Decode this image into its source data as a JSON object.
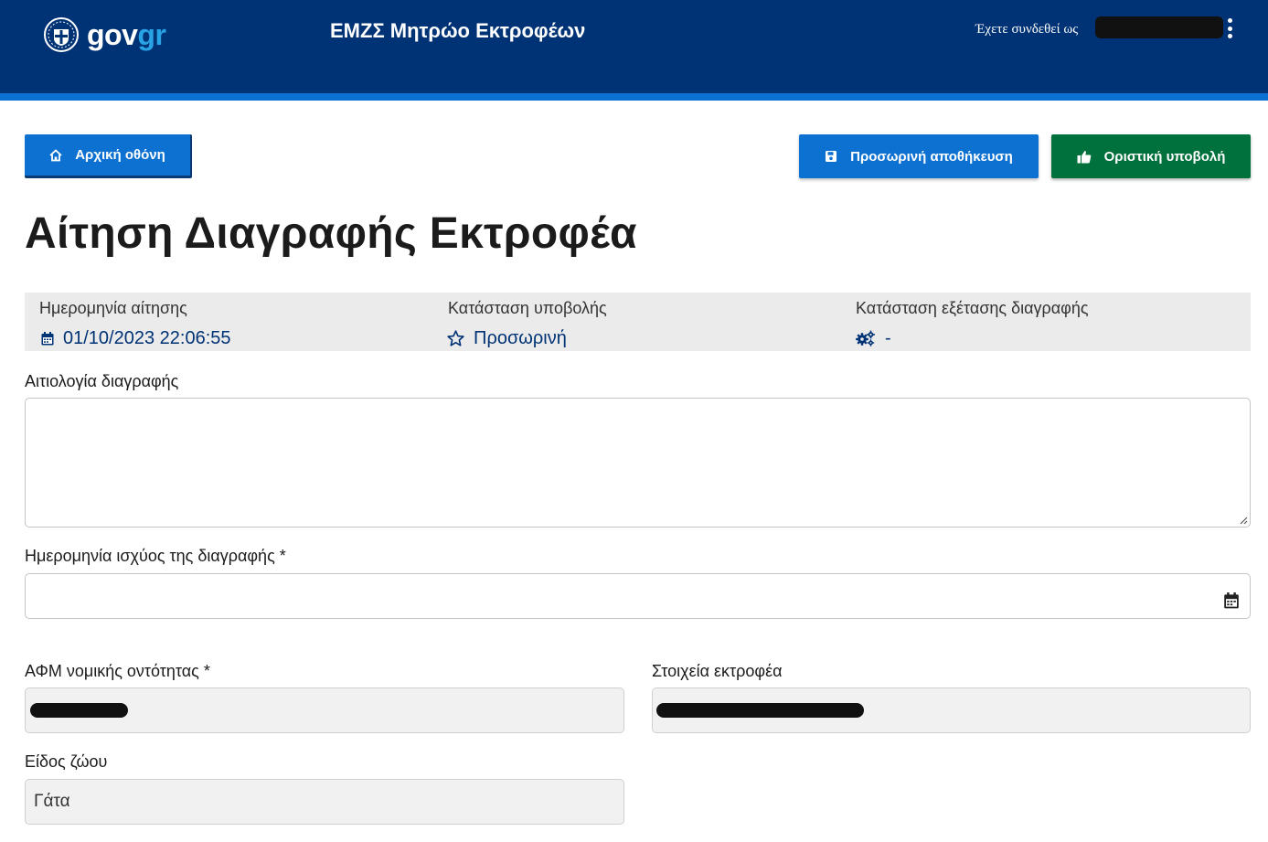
{
  "header": {
    "logo": {
      "gov": "gov",
      "gr": "gr"
    },
    "app_title": "ΕΜΖΣ Μητρώο Εκτροφέων",
    "user_label": "Έχετε συνδεθεί ως",
    "colors": {
      "primary": "#003375",
      "stripe": "#0c71d0",
      "logo_accent": "#29a3e5"
    }
  },
  "actions": {
    "home_label": "Αρχική οθόνη",
    "save_label": "Προσωρινή αποθήκευση",
    "submit_label": "Οριστική υποβολή",
    "colors": {
      "blue": "#0c71d0",
      "green": "#00703c"
    }
  },
  "page_title": "Αίτηση Διαγραφής Εκτροφέα",
  "info": {
    "request_date": {
      "label": "Ημερομηνία αίτησης",
      "value": "01/10/2023 22:06:55",
      "icon": "calendar-icon"
    },
    "submission_status": {
      "label": "Κατάσταση υποβολής",
      "value": "Προσωρινή",
      "icon": "star-outline-icon"
    },
    "review_status": {
      "label": "Κατάσταση εξέτασης διαγραφής",
      "value": "-",
      "icon": "gears-icon"
    }
  },
  "form": {
    "reason": {
      "label": "Αιτιολογία διαγραφής",
      "value": ""
    },
    "effective_date": {
      "label": "Ημερομηνία ισχύος της διαγραφής *",
      "value": ""
    },
    "afm": {
      "label": "ΑΦΜ νομικής οντότητας *"
    },
    "breeder": {
      "label": "Στοιχεία εκτροφέα"
    },
    "species": {
      "label": "Είδος ζώου",
      "value": "Γάτα"
    }
  }
}
